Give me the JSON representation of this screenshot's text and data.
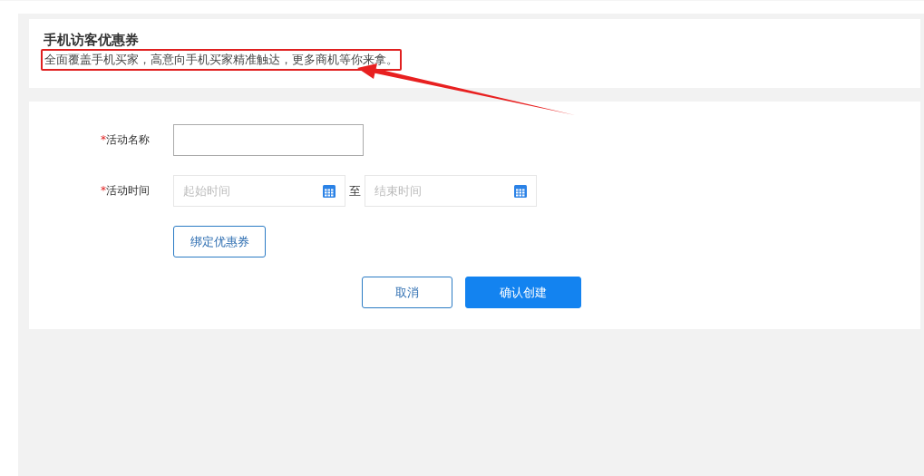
{
  "header": {
    "title": "手机访客优惠券",
    "subtitle": "全面覆盖手机买家，高意向手机买家精准触达，更多商机等你来拿。",
    "highlighted": true
  },
  "form": {
    "fields": [
      {
        "kind": "text",
        "label": "活动名称",
        "required_mark": "*"
      },
      {
        "kind": "daterange",
        "label": "活动时间",
        "required_mark": "*",
        "start_placeholder": "起始时间",
        "separator": "至",
        "end_placeholder": "结束时间"
      }
    ],
    "bind_button": "绑定优惠券",
    "buttons": [
      {
        "label": "取消",
        "primary": false
      },
      {
        "label": "确认创建",
        "primary": true
      }
    ]
  }
}
